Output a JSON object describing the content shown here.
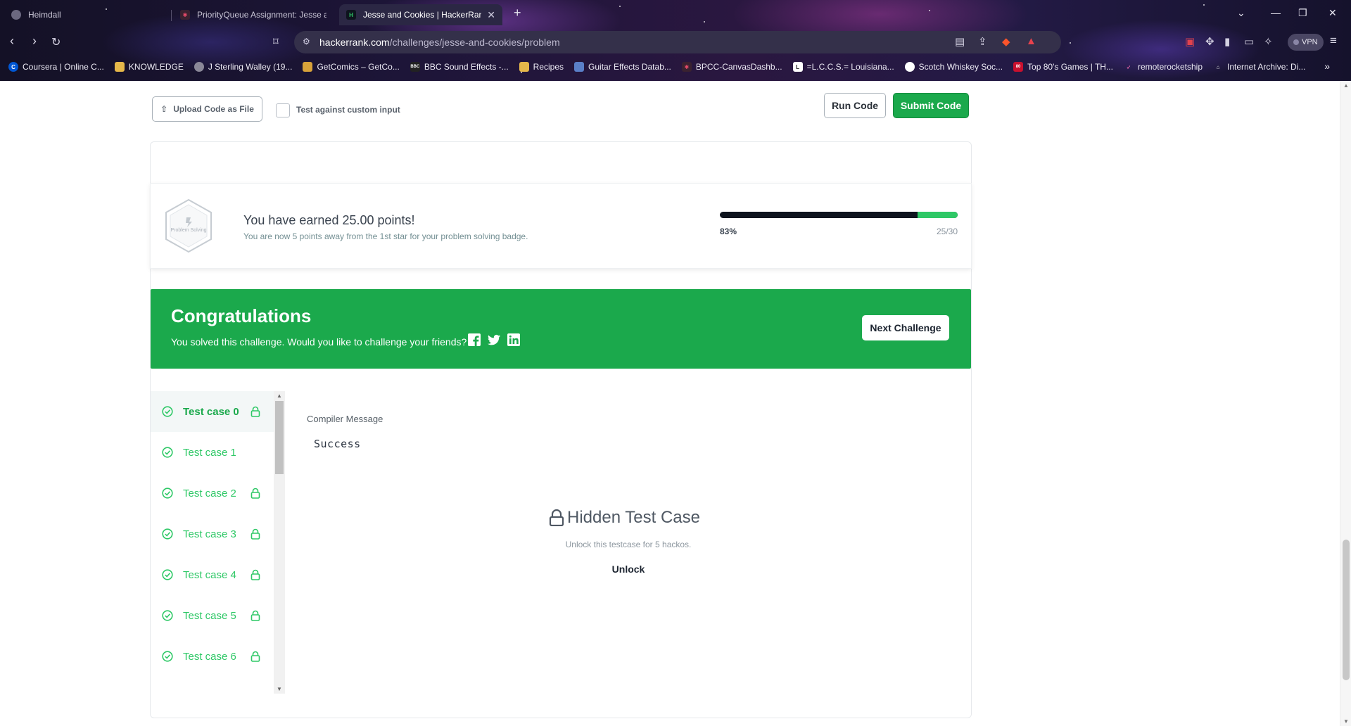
{
  "browser": {
    "tabs": [
      {
        "title": "Heimdall",
        "active": false
      },
      {
        "title": "PriorityQueue Assignment: Jesse an",
        "active": false
      },
      {
        "title": "Jesse and Cookies | HackerRank",
        "active": true
      }
    ],
    "url_host": "hackerrank.com",
    "url_path": "/challenges/jesse-and-cookies/problem",
    "vpn_label": "VPN",
    "bookmarks": [
      "Coursera | Online C...",
      "KNOWLEDGE",
      "J Sterling Walley (19...",
      "GetComics – GetCo...",
      "BBC Sound Effects -...",
      "Recipes",
      "Guitar Effects Datab...",
      "BPCC-CanvasDashb...",
      "=L.C.C.S.= Louisiana...",
      "Scotch Whiskey Soc...",
      "Top 80's Games | TH...",
      "remoterocketship",
      "Internet Archive: Di..."
    ]
  },
  "editor_actions": {
    "upload_label": "Upload Code as File",
    "custom_input_label": "Test against custom input",
    "run_label": "Run Code",
    "submit_label": "Submit Code"
  },
  "points": {
    "badge_label": "Problem Solving",
    "title": "You have earned 25.00 points!",
    "subtitle": "You are now 5 points away from the 1st star for your problem solving badge.",
    "progress_percent_label": "83%",
    "progress_count": "25/30",
    "progress_fraction": 0.83
  },
  "congrats": {
    "title": "Congratulations",
    "text": "You solved this challenge. Would you like to challenge your friends?",
    "next_label": "Next Challenge"
  },
  "test_cases": [
    {
      "label": "Test case 0",
      "locked": true,
      "active": true
    },
    {
      "label": "Test case 1",
      "locked": false,
      "active": false
    },
    {
      "label": "Test case 2",
      "locked": true,
      "active": false
    },
    {
      "label": "Test case 3",
      "locked": true,
      "active": false
    },
    {
      "label": "Test case 4",
      "locked": true,
      "active": false
    },
    {
      "label": "Test case 5",
      "locked": true,
      "active": false
    },
    {
      "label": "Test case 6",
      "locked": true,
      "active": false
    }
  ],
  "result": {
    "compiler_label": "Compiler Message",
    "compiler_value": "Success",
    "hidden_title": "Hidden Test Case",
    "hidden_sub": "Unlock this testcase for 5 hackos.",
    "unlock_label": "Unlock"
  },
  "colors": {
    "accent_green": "#1ba94c",
    "progress_dark": "#0e141e",
    "progress_green": "#2ec866"
  }
}
